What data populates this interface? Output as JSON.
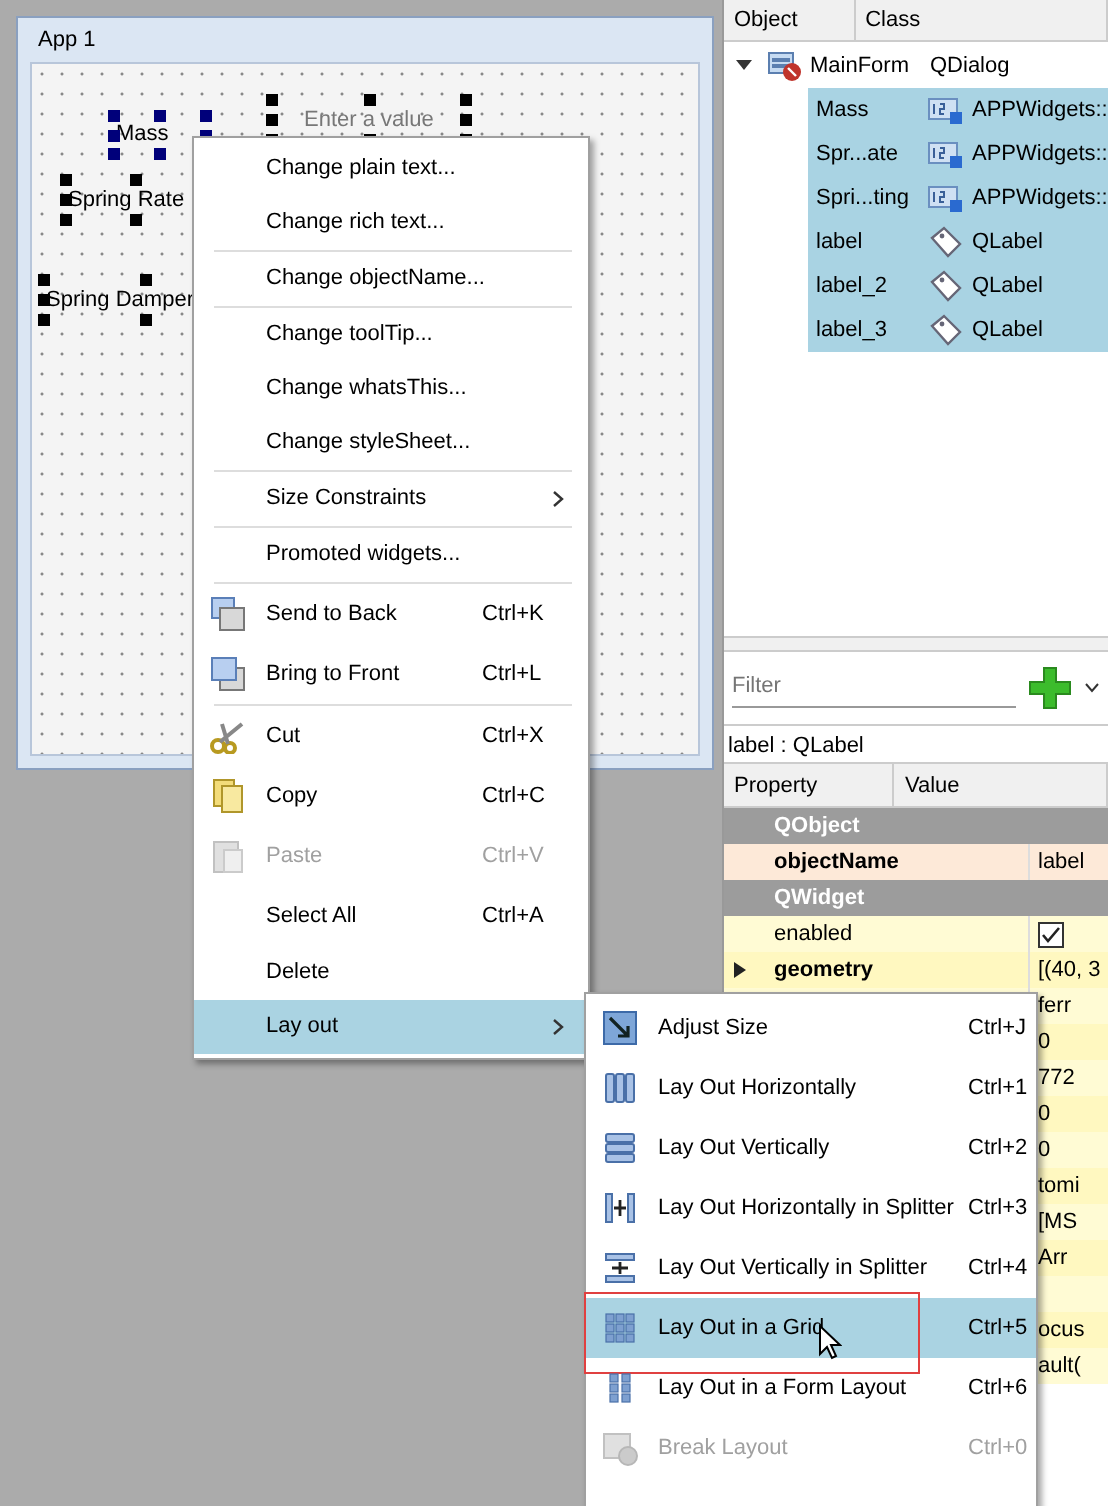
{
  "form_window": {
    "title": "App 1",
    "widgets": [
      {
        "kind": "label",
        "text": "Mass",
        "current": true
      },
      {
        "kind": "label",
        "text": "Spring Rate",
        "current": false
      },
      {
        "kind": "label",
        "text": "Spring Damper",
        "current": false
      },
      {
        "kind": "input",
        "placeholder": "Enter a value",
        "current": false
      }
    ]
  },
  "object_inspector": {
    "columns": [
      "Object",
      "Class"
    ],
    "root": {
      "name": "MainForm",
      "class": "QDialog",
      "expanded": true,
      "selected": false,
      "children": [
        {
          "kind": "custom",
          "name": "Mass",
          "class": "APPWidgets::",
          "selected": true
        },
        {
          "kind": "custom",
          "name": "Spr...ate",
          "class": "APPWidgets::",
          "selected": true
        },
        {
          "kind": "custom",
          "name": "Spri...ting",
          "class": "APPWidgets::",
          "selected": true
        },
        {
          "kind": "label",
          "name": "label",
          "class": "QLabel",
          "selected": true
        },
        {
          "kind": "label",
          "name": "label_2",
          "class": "QLabel",
          "selected": true
        },
        {
          "kind": "label",
          "name": "label_3",
          "class": "QLabel",
          "selected": true
        }
      ]
    }
  },
  "property_editor": {
    "filter_placeholder": "Filter",
    "object_label": "label : QLabel",
    "columns": [
      "Property",
      "Value"
    ],
    "rows": [
      {
        "kind": "group",
        "name": "QObject"
      },
      {
        "kind": "property",
        "name": "objectName",
        "value": "label",
        "changed": true
      },
      {
        "kind": "group",
        "name": "QWidget"
      },
      {
        "kind": "check",
        "name": "enabled",
        "checked": true,
        "changed": false
      },
      {
        "kind": "property",
        "name": "geometry",
        "value": "[(40, 3",
        "changed": true,
        "expandable": true
      },
      {
        "kind": "property",
        "value": "ferr"
      },
      {
        "kind": "property",
        "value": "0"
      },
      {
        "kind": "property",
        "value": "772"
      },
      {
        "kind": "property",
        "value": "0"
      },
      {
        "kind": "property",
        "value": "0"
      },
      {
        "kind": "property",
        "value": "tomi"
      },
      {
        "kind": "property",
        "value": "[MS"
      },
      {
        "kind": "property",
        "value": "Arr"
      },
      {
        "kind": "property"
      },
      {
        "kind": "property",
        "value": "ocus"
      },
      {
        "kind": "property",
        "value": "ault("
      }
    ]
  },
  "context_menu": {
    "items": [
      {
        "kind": "item",
        "label": "Change plain text...",
        "disabled": false,
        "selected": false
      },
      {
        "kind": "item",
        "label": "Change rich text...",
        "disabled": false,
        "selected": false
      },
      {
        "kind": "separator"
      },
      {
        "kind": "item",
        "label": "Change objectName...",
        "disabled": false,
        "selected": false
      },
      {
        "kind": "separator"
      },
      {
        "kind": "item",
        "label": "Change toolTip...",
        "disabled": false,
        "selected": false
      },
      {
        "kind": "item",
        "label": "Change whatsThis...",
        "disabled": false,
        "selected": false
      },
      {
        "kind": "item",
        "label": "Change styleSheet...",
        "disabled": false,
        "selected": false
      },
      {
        "kind": "separator"
      },
      {
        "kind": "item",
        "label": "Size Constraints",
        "submenu": true,
        "disabled": false,
        "selected": false
      },
      {
        "kind": "separator"
      },
      {
        "kind": "item",
        "label": "Promoted widgets...",
        "disabled": false,
        "selected": false
      },
      {
        "kind": "separator"
      },
      {
        "kind": "item",
        "label": "Send to Back",
        "shortcut": "Ctrl+K",
        "disabled": false,
        "selected": false
      },
      {
        "kind": "item",
        "label": "Bring to Front",
        "shortcut": "Ctrl+L",
        "disabled": false,
        "selected": false
      },
      {
        "kind": "separator"
      },
      {
        "kind": "item",
        "label": "Cut",
        "shortcut": "Ctrl+X",
        "disabled": false,
        "selected": false
      },
      {
        "kind": "item",
        "label": "Copy",
        "shortcut": "Ctrl+C",
        "disabled": false,
        "selected": false
      },
      {
        "kind": "item",
        "label": "Paste",
        "shortcut": "Ctrl+V",
        "disabled": true,
        "selected": false
      },
      {
        "kind": "item",
        "label": "Select All",
        "shortcut": "Ctrl+A",
        "disabled": false,
        "selected": false
      },
      {
        "kind": "item",
        "label": "Delete",
        "disabled": false,
        "selected": false
      },
      {
        "kind": "item",
        "label": "Lay out",
        "submenu": true,
        "disabled": false,
        "selected": true
      }
    ]
  },
  "layout_submenu": {
    "items": [
      {
        "kind": "item",
        "label": "Adjust Size",
        "shortcut": "Ctrl+J",
        "disabled": false,
        "selected": false
      },
      {
        "kind": "item",
        "label": "Lay Out Horizontally",
        "shortcut": "Ctrl+1",
        "disabled": false,
        "selected": false
      },
      {
        "kind": "item",
        "label": "Lay Out Vertically",
        "shortcut": "Ctrl+2",
        "disabled": false,
        "selected": false
      },
      {
        "kind": "item",
        "label": "Lay Out Horizontally in Splitter",
        "shortcut": "Ctrl+3",
        "disabled": false,
        "selected": false
      },
      {
        "kind": "item",
        "label": "Lay Out Vertically in Splitter",
        "shortcut": "Ctrl+4",
        "disabled": false,
        "selected": false
      },
      {
        "kind": "item",
        "label": "Lay Out in a Grid",
        "shortcut": "Ctrl+5",
        "disabled": false,
        "selected": true,
        "annotated": true,
        "cursor": true
      },
      {
        "kind": "item",
        "label": "Lay Out in a Form Layout",
        "shortcut": "Ctrl+6",
        "disabled": false,
        "selected": false
      },
      {
        "kind": "item",
        "label": "Break Layout",
        "shortcut": "Ctrl+0",
        "disabled": true,
        "selected": false
      }
    ]
  }
}
